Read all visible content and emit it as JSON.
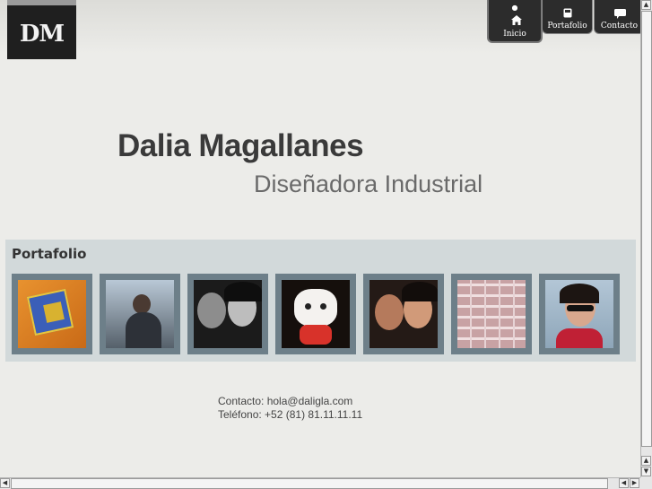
{
  "logo": {
    "text": "DM"
  },
  "nav": {
    "items": [
      {
        "label": "Inicio",
        "icon": "home-icon"
      },
      {
        "label": "Portafolio",
        "icon": "phone-icon"
      },
      {
        "label": "Contacto",
        "icon": "speech-bubble-icon"
      }
    ]
  },
  "hero": {
    "name": "Dalia Magallanes",
    "subtitle": "Diseñadora Industrial"
  },
  "portfolio": {
    "title": "Portafolio",
    "thumbnails": [
      {
        "subject": "rubiks-cube-photo"
      },
      {
        "subject": "city-couple-photo"
      },
      {
        "subject": "couple-bw-photo"
      },
      {
        "subject": "cat-figure-photo"
      },
      {
        "subject": "couple-color-photo"
      },
      {
        "subject": "boxes-photo"
      },
      {
        "subject": "woman-sunglasses-photo"
      }
    ]
  },
  "contact": {
    "email_line": "Contacto: hola@daligla.com",
    "phone_line": "Teléfono: +52 (81) 81.11.11.11"
  },
  "colors": {
    "background": "#ecece9",
    "nav_bg": "#2c2c2c",
    "portfolio_band": "#d2d9da",
    "thumb_frame": "#6d7f89"
  }
}
